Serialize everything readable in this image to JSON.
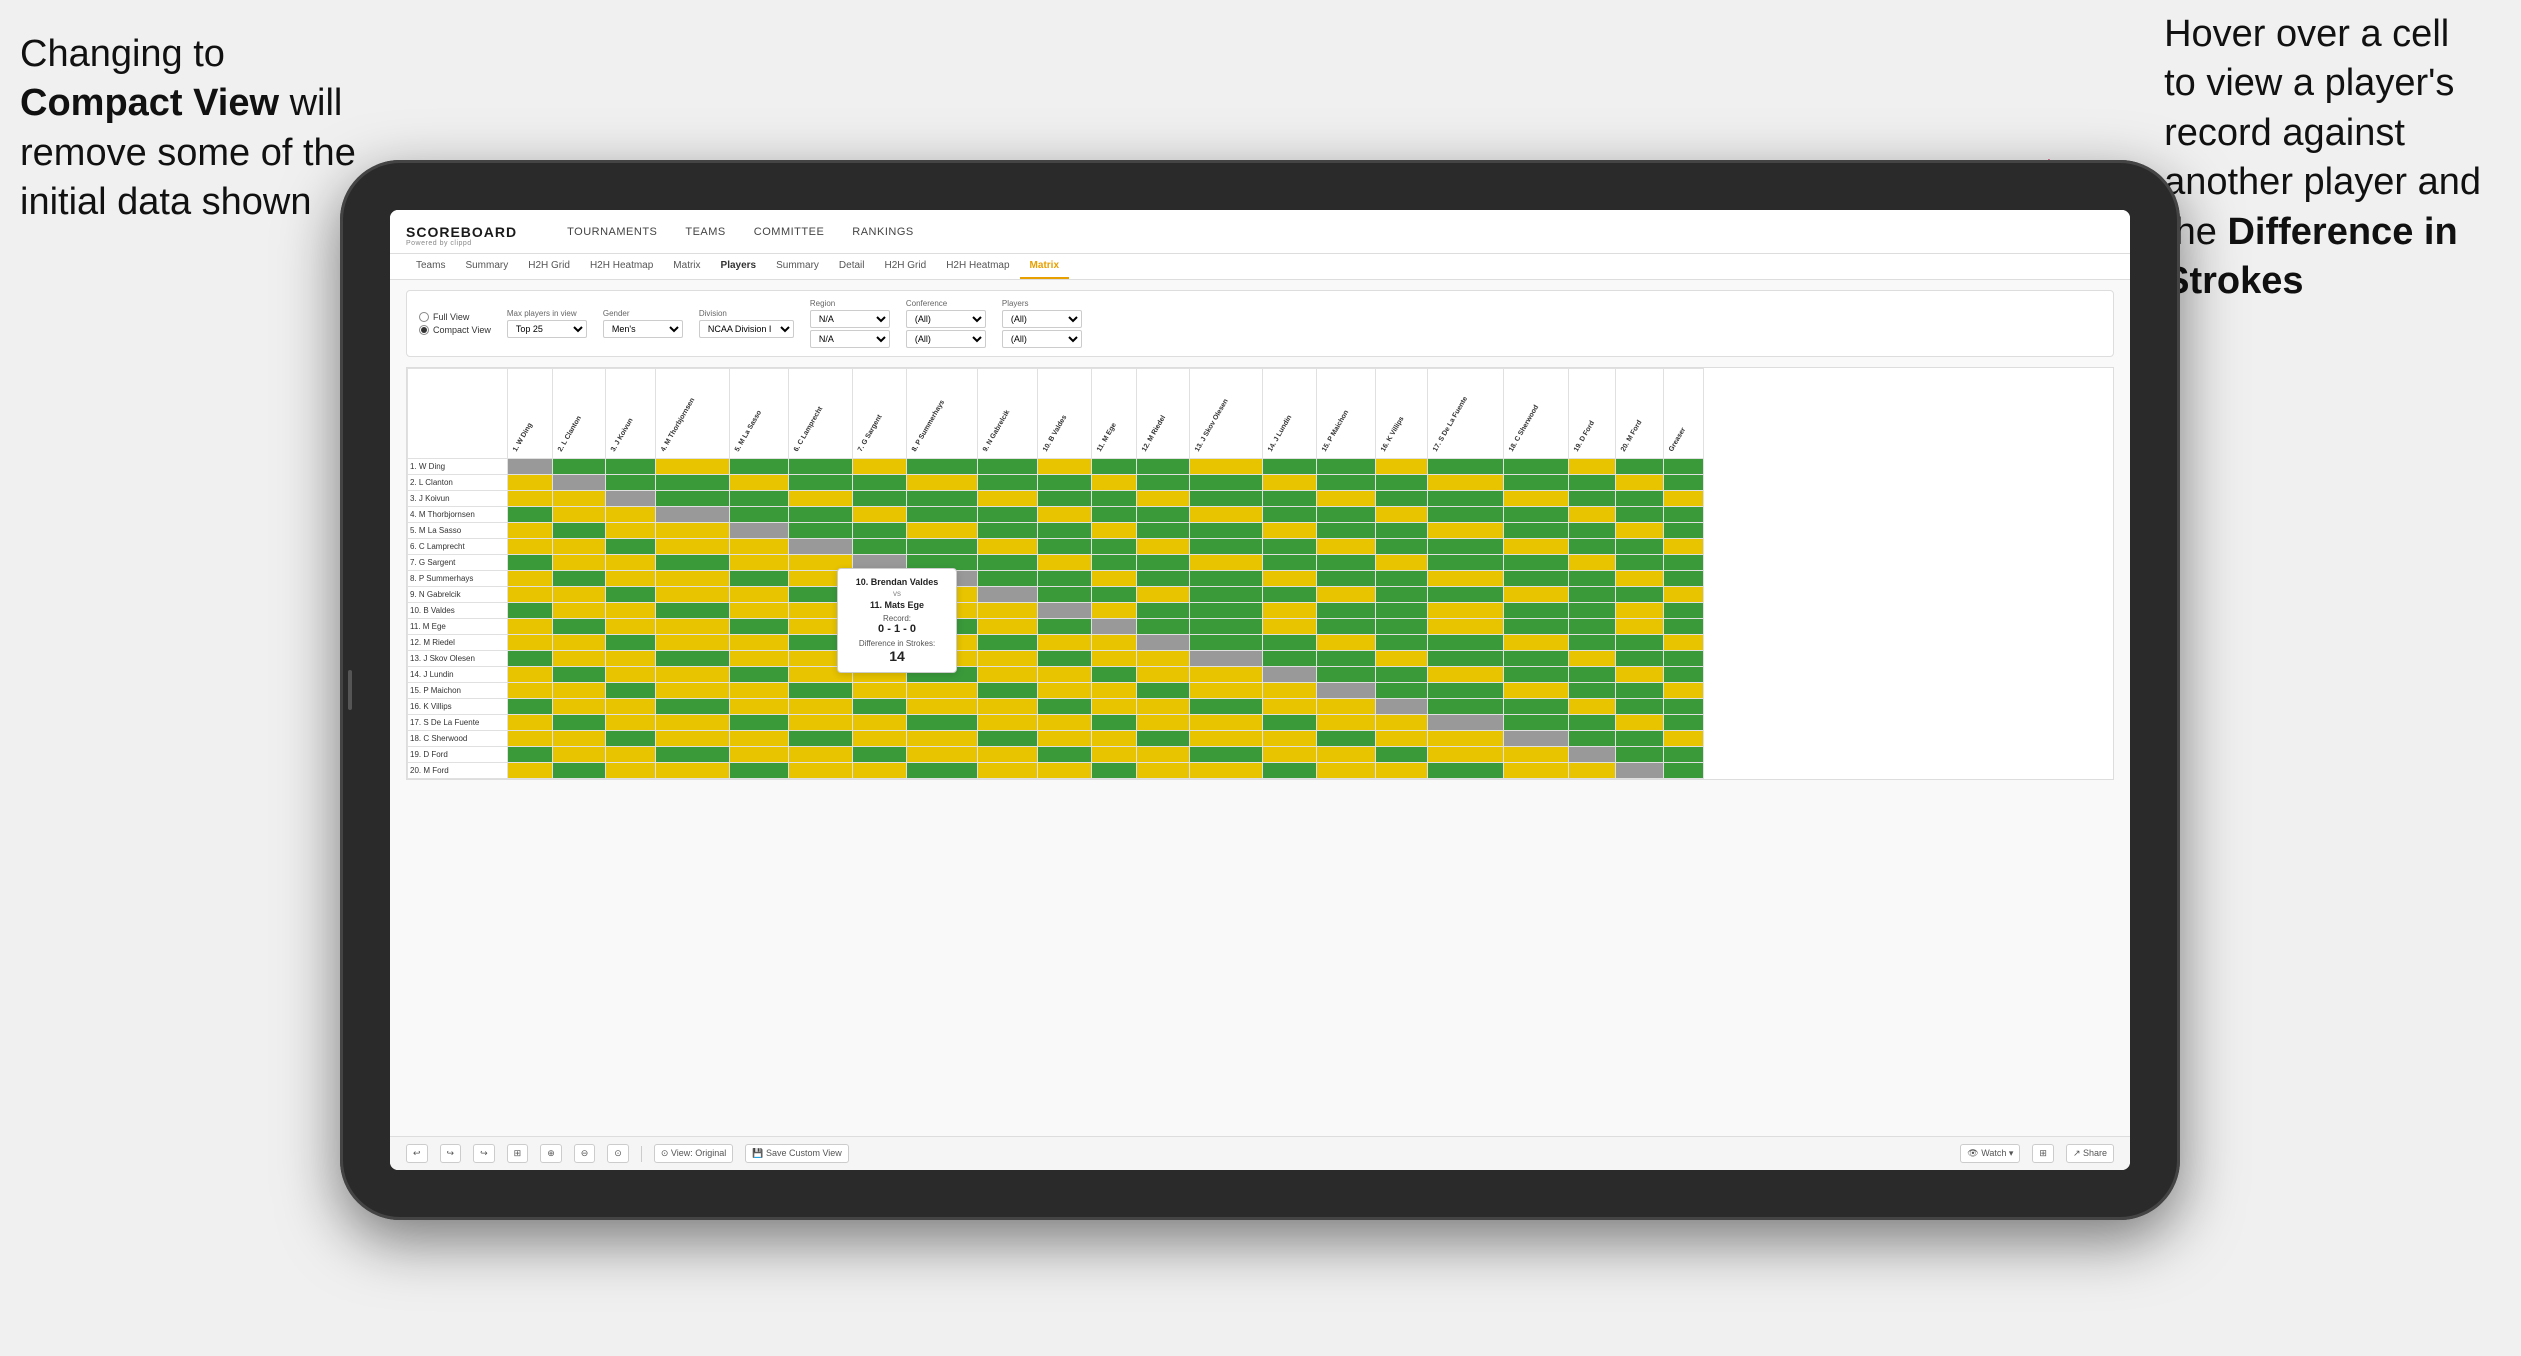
{
  "annotations": {
    "left": {
      "line1": "Changing to",
      "line2_bold": "Compact View",
      "line2_rest": " will",
      "line3": "remove some of the",
      "line4": "initial data shown"
    },
    "right": {
      "line1": "Hover over a cell",
      "line2": "to view a player's",
      "line3": "record against",
      "line4": "another player and",
      "line5_pre": "the ",
      "line5_bold": "Difference in",
      "line6_bold": "Strokes"
    }
  },
  "nav": {
    "logo": "SCOREBOARD",
    "logo_sub": "Powered by clippd",
    "items": [
      "TOURNAMENTS",
      "TEAMS",
      "COMMITTEE",
      "RANKINGS"
    ]
  },
  "sub_tabs": {
    "left_group": [
      "Teams",
      "Summary",
      "H2H Grid",
      "H2H Heatmap",
      "Matrix"
    ],
    "right_group_label": "Players",
    "right_group": [
      "Summary",
      "Detail",
      "H2H Grid",
      "H2H Heatmap",
      "Matrix"
    ],
    "active": "Matrix"
  },
  "filters": {
    "view_options": [
      "Full View",
      "Compact View"
    ],
    "selected_view": "Compact View",
    "max_players_label": "Max players in view",
    "max_players_value": "Top 25",
    "gender_label": "Gender",
    "gender_value": "Men's",
    "division_label": "Division",
    "division_value": "NCAA Division I",
    "region_label": "Region",
    "region_values": [
      "N/A",
      "N/A"
    ],
    "conference_label": "Conference",
    "conference_values": [
      "(All)",
      "(All)"
    ],
    "players_label": "Players",
    "players_values": [
      "(All)",
      "(All)"
    ]
  },
  "column_headers": [
    "1. W Ding",
    "2. L Clanton",
    "3. J Koivun",
    "4. M Thorbjornsen",
    "5. M La Sasso",
    "6. C Lamprecht",
    "7. G Sargent",
    "8. P Summerhays",
    "9. N Gabrelcik",
    "10. B Valdes",
    "11. M Ege",
    "12. M Riedel",
    "13. J Skov Olesen",
    "14. J Lundin",
    "15. P Maichon",
    "16. K Villips",
    "17. S De La Fuente",
    "18. C Sherwood",
    "19. D Ford",
    "20. M Ford",
    "Greaser"
  ],
  "row_headers": [
    "1. W Ding",
    "2. L Clanton",
    "3. J Koivun",
    "4. M Thorbjornsen",
    "5. M La Sasso",
    "6. C Lamprecht",
    "7. G Sargent",
    "8. P Summerhays",
    "9. N Gabrelcik",
    "10. B Valdes",
    "11. M Ege",
    "12. M Riedel",
    "13. J Skov Olesen",
    "14. J Lundin",
    "15. P Maichon",
    "16. K Villips",
    "17. S De La Fuente",
    "18. C Sherwood",
    "19. D Ford",
    "20. M Ford"
  ],
  "tooltip": {
    "player1": "10. Brendan Valdes",
    "vs": "vs",
    "player2": "11. Mats Ege",
    "record_label": "Record:",
    "record": "0 - 1 - 0",
    "diff_label": "Difference in Strokes:",
    "diff": "14"
  },
  "toolbar": {
    "undo": "↩",
    "redo": "↪",
    "view_original": "⊙ View: Original",
    "save_custom": "💾 Save Custom View",
    "watch": "👁 Watch ▾",
    "share": "↗ Share"
  },
  "colors": {
    "green": "#3a9a3a",
    "yellow": "#e8c400",
    "gray": "#c0c0c0",
    "active_tab": "#e8a000",
    "diagonal": "#999999"
  }
}
